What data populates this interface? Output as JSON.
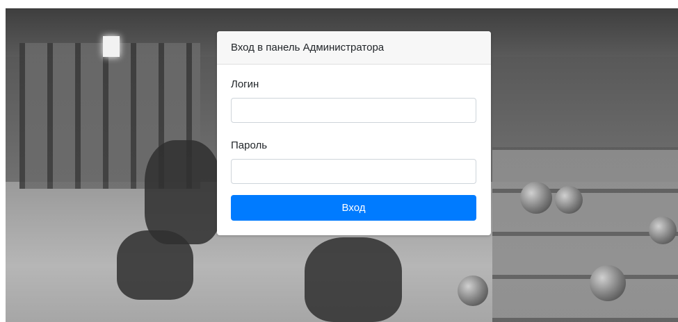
{
  "login_card": {
    "header_title": "Вход в панель Администратора",
    "login_label": "Логин",
    "login_value": "",
    "password_label": "Пароль",
    "password_value": "",
    "submit_label": "Вход"
  },
  "colors": {
    "primary_button": "#007bff",
    "card_header_bg": "#f7f7f7"
  },
  "background": {
    "description_icon": "gym-photo-background"
  }
}
